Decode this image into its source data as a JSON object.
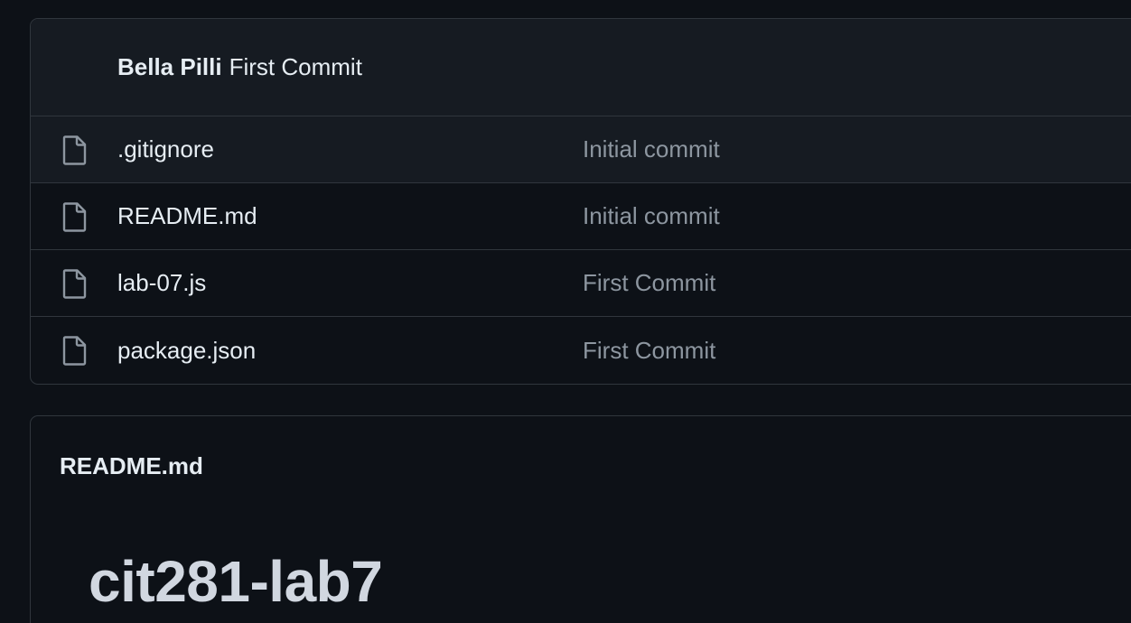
{
  "latest_commit": {
    "author": "Bella Pilli",
    "message": "First Commit"
  },
  "files": [
    {
      "name": ".gitignore",
      "commit": "Initial commit",
      "icon": "file-icon"
    },
    {
      "name": "README.md",
      "commit": "Initial commit",
      "icon": "file-icon"
    },
    {
      "name": "lab-07.js",
      "commit": "First Commit",
      "icon": "file-icon"
    },
    {
      "name": "package.json",
      "commit": "First Commit",
      "icon": "file-icon"
    }
  ],
  "readme": {
    "filename": "README.md",
    "heading": "cit281-lab7"
  },
  "colors": {
    "background": "#0d1117",
    "header_bg": "#161b22",
    "border": "#30363d",
    "text_primary": "#e6edf3",
    "text_muted": "#8d96a0"
  }
}
